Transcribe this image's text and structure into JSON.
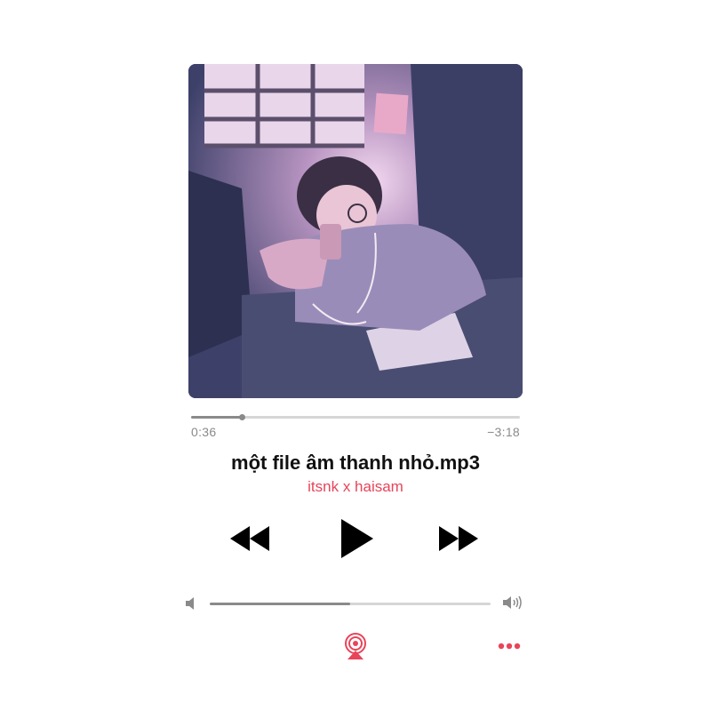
{
  "track": {
    "title": "một file âm thanh nhỏ.mp3",
    "artist": "itsnk x haisam"
  },
  "playback": {
    "elapsed": "0:36",
    "remaining": "−3:18",
    "progress_fraction": 0.155
  },
  "volume": {
    "level_fraction": 0.5
  },
  "controls": {
    "rewind_icon": "rewind-icon",
    "play_icon": "play-icon",
    "forward_icon": "fast-forward-icon",
    "airplay_icon": "airplay-icon",
    "more_icon": "more-options-icon",
    "volume_low_icon": "speaker-low-icon",
    "volume_high_icon": "speaker-high-icon"
  },
  "colors": {
    "accent": "#e8445a",
    "text": "#111111",
    "muted": "#8a8a8a"
  }
}
